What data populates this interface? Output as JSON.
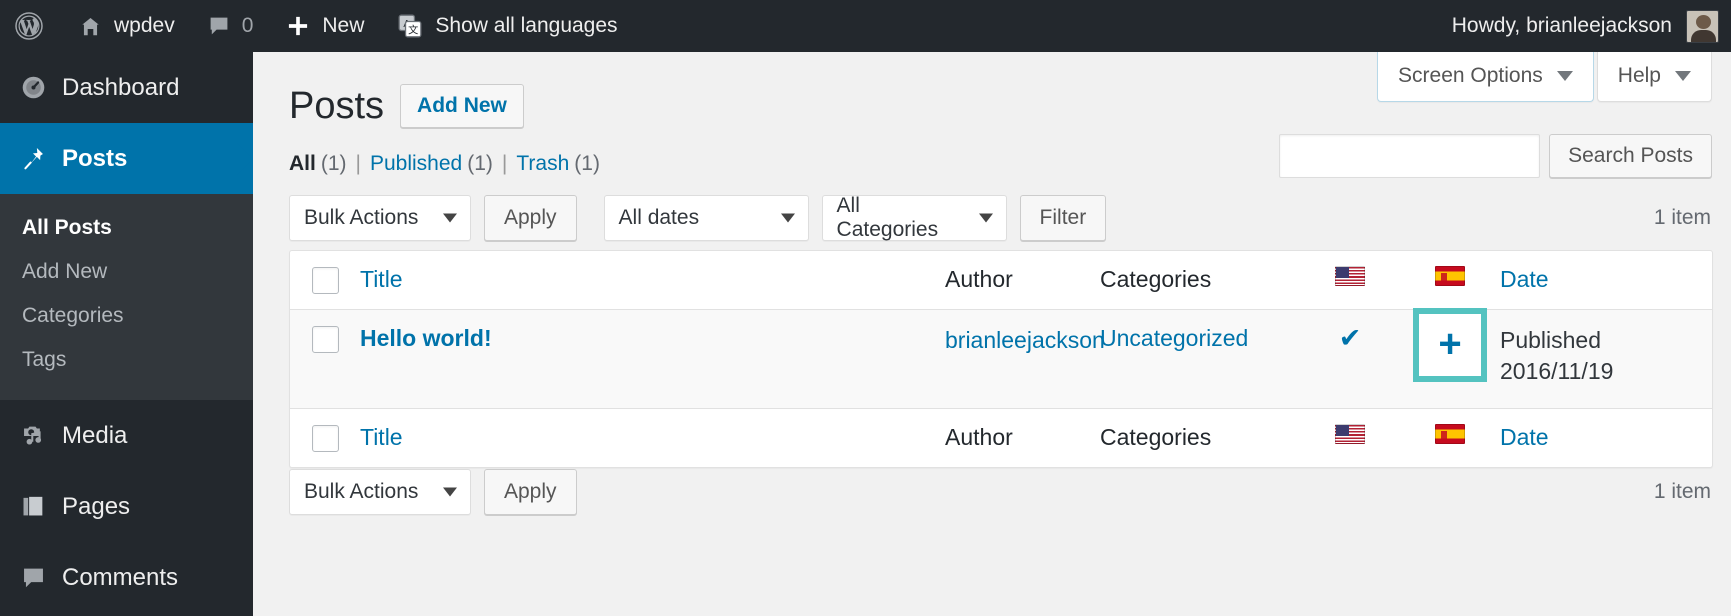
{
  "adminbar": {
    "logo_icon": "wordpress-logo-icon",
    "site_icon": "home-icon",
    "site_name": "wpdev",
    "comments_icon": "comment-bubble-icon",
    "comments_count": "0",
    "new_icon": "plus-icon",
    "new_label": "New",
    "languages_icon": "translate-icon",
    "languages_label": "Show all languages",
    "howdy": "Howdy, brianleejackson",
    "avatar": "user-avatar"
  },
  "sidebar": {
    "items": [
      {
        "label": "Dashboard",
        "icon": "dashboard-icon",
        "current": false
      },
      {
        "label": "Posts",
        "icon": "pin-icon",
        "current": true
      },
      {
        "label": "Media",
        "icon": "media-icon",
        "current": false
      },
      {
        "label": "Pages",
        "icon": "pages-icon",
        "current": false
      },
      {
        "label": "Comments",
        "icon": "comment-bubble-icon",
        "current": false
      }
    ],
    "submenu": [
      {
        "label": "All Posts",
        "current": true
      },
      {
        "label": "Add New",
        "current": false
      },
      {
        "label": "Categories",
        "current": false
      },
      {
        "label": "Tags",
        "current": false
      }
    ]
  },
  "screen_meta": {
    "screen_options": "Screen Options",
    "help": "Help",
    "caret_icon": "chevron-down-icon"
  },
  "page": {
    "title": "Posts",
    "add_new": "Add New"
  },
  "views": {
    "all": {
      "label": "All",
      "count": "(1)"
    },
    "published": {
      "label": "Published",
      "count": "(1)"
    },
    "trash": {
      "label": "Trash",
      "count": "(1)"
    },
    "separator": "|"
  },
  "search": {
    "value": "",
    "placeholder": "",
    "submit": "Search Posts"
  },
  "tablenav_top": {
    "bulk_actions": "Bulk Actions",
    "apply": "Apply",
    "all_dates": "All dates",
    "all_categories": "All Categories",
    "filter": "Filter",
    "displaying": "1 item"
  },
  "tablenav_bottom": {
    "bulk_actions": "Bulk Actions",
    "apply": "Apply",
    "displaying": "1 item"
  },
  "table": {
    "columns": {
      "title": "Title",
      "author": "Author",
      "categories": "Categories",
      "flag_en": "flag-us-icon",
      "flag_es": "flag-spain-icon",
      "date": "Date"
    },
    "rows": [
      {
        "title": "Hello world!",
        "author": "brianleejackson",
        "categories": "Uncategorized",
        "lang_en": "check-icon",
        "lang_es": "plus-icon",
        "date_status": "Published",
        "date_value": "2016/11/19"
      }
    ]
  },
  "colors": {
    "admin_bar": "#23282d",
    "sidebar": "#23282d",
    "sidebar_current": "#0073aa",
    "link": "#0073aa",
    "highlight": "#54c3c0",
    "page_bg": "#f1f1f1"
  }
}
